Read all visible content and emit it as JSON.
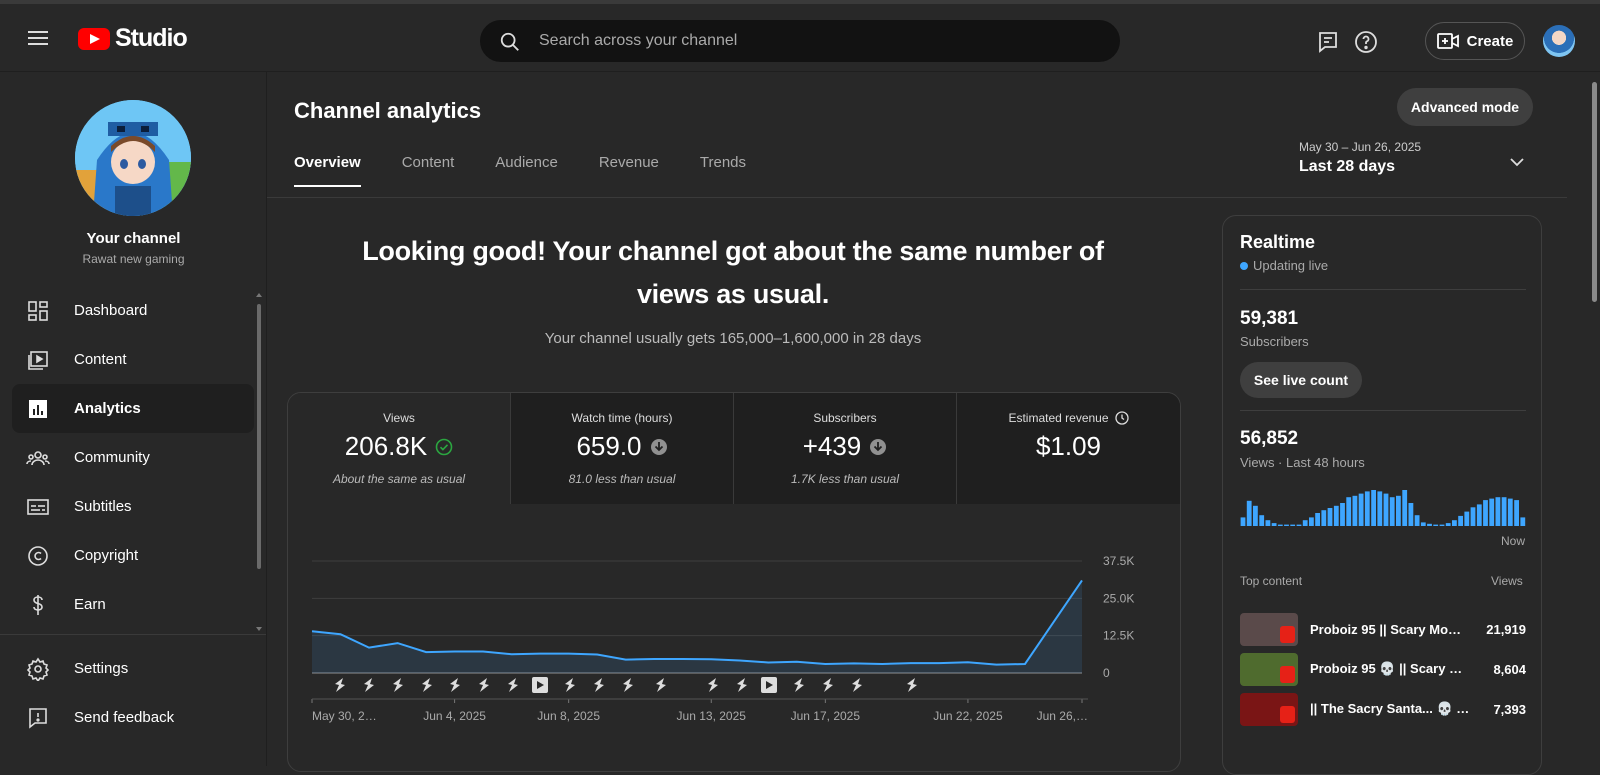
{
  "topbar": {
    "logo_text": "Studio",
    "search_placeholder": "Search across your channel",
    "create_label": "Create"
  },
  "sidebar": {
    "channel_title": "Your channel",
    "channel_handle": "Rawat new gaming",
    "items": [
      {
        "label": "Dashboard",
        "icon": "dashboard-icon"
      },
      {
        "label": "Content",
        "icon": "content-icon"
      },
      {
        "label": "Analytics",
        "icon": "analytics-icon",
        "active": true
      },
      {
        "label": "Community",
        "icon": "community-icon"
      },
      {
        "label": "Subtitles",
        "icon": "subtitles-icon"
      },
      {
        "label": "Copyright",
        "icon": "copyright-icon"
      },
      {
        "label": "Earn",
        "icon": "earn-icon"
      }
    ],
    "bottom_items": [
      {
        "label": "Settings",
        "icon": "gear-icon"
      },
      {
        "label": "Send feedback",
        "icon": "feedback-icon"
      }
    ]
  },
  "main": {
    "title": "Channel analytics",
    "advanced_label": "Advanced mode",
    "tabs": [
      "Overview",
      "Content",
      "Audience",
      "Revenue",
      "Trends"
    ],
    "date_range": "May 30 – Jun 26, 2025",
    "date_label": "Last 28 days",
    "headline": "Looking good! Your channel got about the same number of views as usual.",
    "subline": "Your channel usually gets 165,000–1,600,000 in 28 days",
    "metrics": [
      {
        "label": "Views",
        "value": "206.8K",
        "note": "About the same as usual",
        "indicator": "check"
      },
      {
        "label": "Watch time (hours)",
        "value": "659.0",
        "note": "81.0 less than usual",
        "indicator": "down"
      },
      {
        "label": "Subscribers",
        "value": "+439",
        "note": "1.7K less than usual",
        "indicator": "down"
      },
      {
        "label": "Estimated revenue",
        "value": "$1.09",
        "note": "",
        "indicator": "clock"
      }
    ]
  },
  "chart_data": {
    "type": "area",
    "x": [
      "May 30",
      "May 31",
      "Jun 1",
      "Jun 2",
      "Jun 3",
      "Jun 4",
      "Jun 5",
      "Jun 6",
      "Jun 7",
      "Jun 8",
      "Jun 9",
      "Jun 10",
      "Jun 11",
      "Jun 12",
      "Jun 13",
      "Jun 14",
      "Jun 15",
      "Jun 16",
      "Jun 17",
      "Jun 18",
      "Jun 19",
      "Jun 20",
      "Jun 21",
      "Jun 22",
      "Jun 23",
      "Jun 24",
      "Jun 25",
      "Jun 26"
    ],
    "x_tick_labels": [
      "May 30, 2…",
      "Jun 4, 2025",
      "Jun 8, 2025",
      "Jun 13, 2025",
      "Jun 17, 2025",
      "Jun 22, 2025",
      "Jun 26,…"
    ],
    "x_tick_dates": [
      "May 30",
      "Jun 4",
      "Jun 8",
      "Jun 13",
      "Jun 17",
      "Jun 22",
      "Jun 26"
    ],
    "y_tick_labels": [
      "37.5K",
      "25.0K",
      "12.5K",
      "0"
    ],
    "ylim": [
      0,
      37500
    ],
    "series": [
      {
        "values": [
          14000,
          13000,
          8500,
          10000,
          7000,
          7200,
          7200,
          6300,
          6500,
          6500,
          6200,
          4500,
          4700,
          4700,
          4600,
          4200,
          3500,
          3800,
          3000,
          3200,
          3000,
          3300,
          3300,
          3600,
          2800,
          3000,
          17000,
          31000
        ]
      }
    ],
    "line_color": "#3ea6ff",
    "grid": true,
    "upload_markers": [
      "short",
      "short",
      "short",
      "short",
      "short",
      "short",
      "short",
      "video",
      "short",
      "short",
      "short",
      "short",
      "short",
      "short",
      "video",
      "short",
      "short",
      "short",
      "short"
    ]
  },
  "realtime": {
    "title": "Realtime",
    "status": "Updating live",
    "subscribers": "59,381",
    "subscribers_label": "Subscribers",
    "live_count_label": "See live count",
    "views": "56,852",
    "views_label": "Views · Last 48 hours",
    "now_label": "Now",
    "hourly_views": [
      12,
      35,
      28,
      15,
      8,
      4,
      2,
      2,
      2,
      2,
      8,
      12,
      18,
      22,
      25,
      28,
      32,
      40,
      42,
      45,
      48,
      50,
      48,
      45,
      40,
      42,
      50,
      32,
      15,
      5,
      3,
      2,
      2,
      4,
      8,
      14,
      20,
      26,
      30,
      36,
      38,
      40,
      40,
      38,
      36,
      12
    ],
    "top_content_label": "Top content",
    "top_views_label": "Views",
    "top_content": [
      {
        "title": "Proboiz 95 || Scary Mom…",
        "views": "21,919",
        "thumb_color": "#5a4a4a"
      },
      {
        "title": "Proboiz 95 💀 || Scary M…",
        "views": "8,604",
        "thumb_color": "#4f6b2e"
      },
      {
        "title": "|| The Sacry Santa... 💀 ||…",
        "views": "7,393",
        "thumb_color": "#7a1515"
      }
    ]
  }
}
